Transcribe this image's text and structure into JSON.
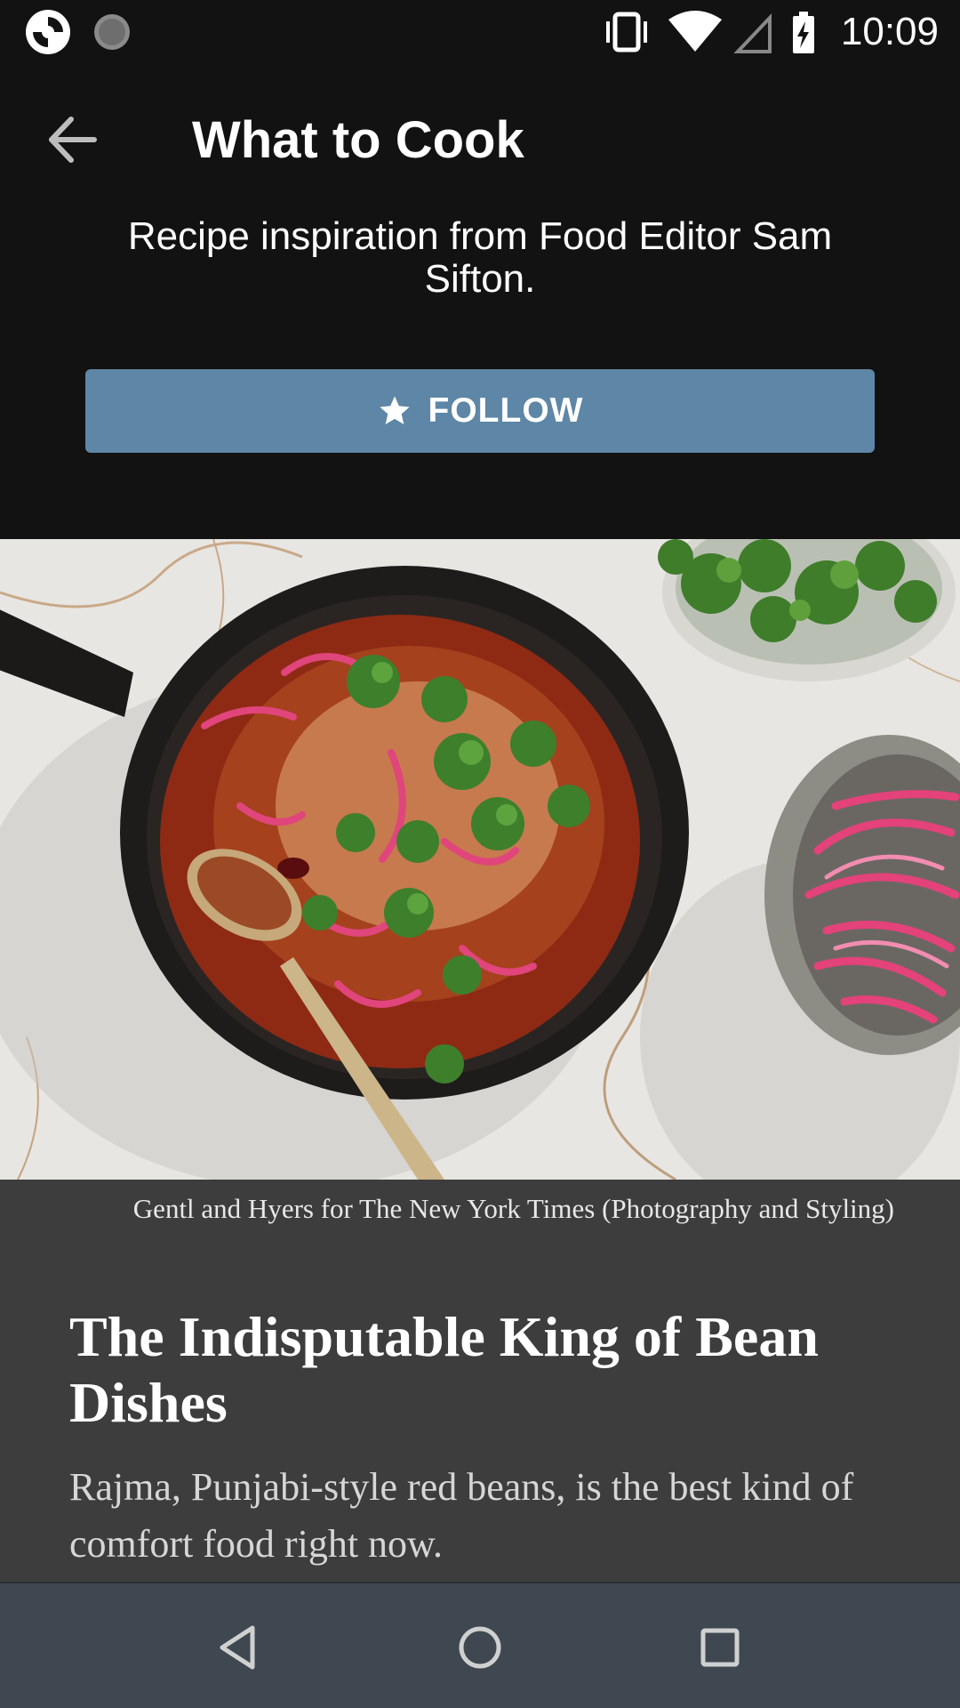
{
  "status_bar": {
    "time": "10:09",
    "icons": [
      "camera-shutter-icon",
      "loading-icon",
      "vibrate-icon",
      "wifi-icon",
      "cellular-signal-icon",
      "battery-charging-icon"
    ]
  },
  "app_bar": {
    "title": "What to Cook",
    "back_icon": "arrow-back-icon"
  },
  "header": {
    "subtitle": "Recipe inspiration from Food Editor Sam Sifton.",
    "follow_label": "FOLLOW",
    "follow_icon": "star-icon"
  },
  "article": {
    "image_alt": "Rajma in a cast-iron skillet with cilantro and pickled red onions",
    "caption": "Gentl and Hyers for The New York Times (Photography and Styling)",
    "headline": "The Indisputable King of Bean Dishes",
    "summary": "Rajma, Punjabi-style red beans, is the best kind of comfort food right now."
  },
  "nav_bar": {
    "icons": [
      "back-nav-icon",
      "home-nav-icon",
      "recents-nav-icon"
    ]
  },
  "colors": {
    "background": "#121212",
    "follow_button": "#5e86a6",
    "card": "#3d3d3d",
    "nav_bar": "#3f4850"
  }
}
